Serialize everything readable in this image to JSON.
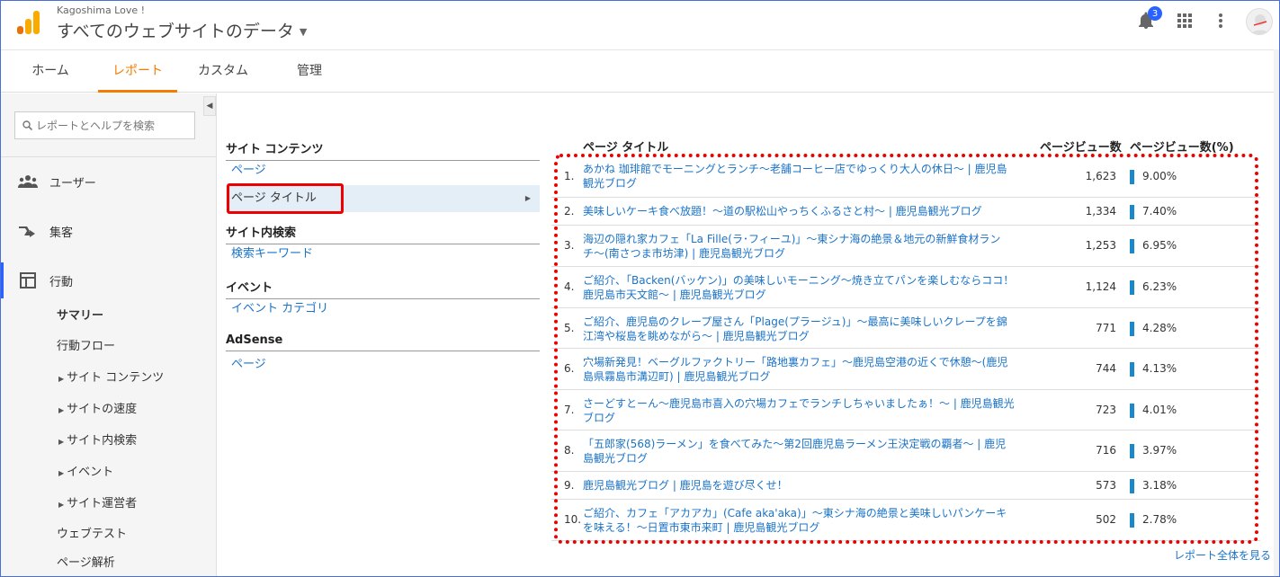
{
  "header": {
    "account": "Kagoshima Love !",
    "property": "すべてのウェブサイトのデータ",
    "notification_count": "3"
  },
  "tabs": [
    {
      "label": "ホーム",
      "active": false
    },
    {
      "label": "レポート",
      "active": true
    },
    {
      "label": "カスタム",
      "active": false
    },
    {
      "label": "管理",
      "active": false
    }
  ],
  "sidebar": {
    "search_placeholder": "レポートとヘルプを検索",
    "main": [
      {
        "label": "ユーザー",
        "icon": "users-icon"
      },
      {
        "label": "集客",
        "icon": "acquisition-icon"
      },
      {
        "label": "行動",
        "icon": "behavior-icon",
        "active": true
      }
    ],
    "sub": [
      {
        "label": "サマリー",
        "bold": true
      },
      {
        "label": "行動フロー"
      },
      {
        "label": "サイト コンテンツ",
        "expandable": true
      },
      {
        "label": "サイトの速度",
        "expandable": true
      },
      {
        "label": "サイト内検索",
        "expandable": true
      },
      {
        "label": "イベント",
        "expandable": true
      },
      {
        "label": "サイト運営者",
        "expandable": true
      },
      {
        "label": "ウェブテスト"
      },
      {
        "label": "ページ解析"
      }
    ]
  },
  "sections": {
    "site_content": {
      "title": "サイト コンテンツ",
      "links": [
        "ページ",
        "ページ タイトル"
      ]
    },
    "site_search": {
      "title": "サイト内検索",
      "links": [
        "検索キーワード"
      ]
    },
    "events": {
      "title": "イベント",
      "links": [
        "イベント カテゴリ"
      ]
    },
    "adsense": {
      "title": "AdSense",
      "links": [
        "ページ"
      ]
    }
  },
  "table": {
    "col_title": "ページ タイトル",
    "col_pv": "ページビュー数",
    "col_pct": "ページビュー数(%)",
    "rows": [
      {
        "rank": "1.",
        "title": "あかね 珈琲館でモーニングとランチ〜老舗コーヒー店でゆっくり大人の休日〜 | 鹿児島観光ブログ",
        "pv": "1,623",
        "pct": "9.00%",
        "share": 9.0
      },
      {
        "rank": "2.",
        "title": "美味しいケーキ食べ放題！〜道の駅松山やっちくふるさと村〜 | 鹿児島観光ブログ",
        "pv": "1,334",
        "pct": "7.40%",
        "share": 7.4
      },
      {
        "rank": "3.",
        "title": "海辺の隠れ家カフェ「La Fille(ラ･フィーユ)」〜東シナ海の絶景＆地元の新鮮食材ランチ〜(南さつま市坊津) | 鹿児島観光ブログ",
        "pv": "1,253",
        "pct": "6.95%",
        "share": 6.95
      },
      {
        "rank": "4.",
        "title": "ご紹介、「Backen(バッケン)」の美味しいモーニング〜焼き立てパンを楽しむならココ！ 鹿児島市天文館〜 | 鹿児島観光ブログ",
        "pv": "1,124",
        "pct": "6.23%",
        "share": 6.23
      },
      {
        "rank": "5.",
        "title": "ご紹介、鹿児島のクレープ屋さん「Plage(プラージュ)」〜最高に美味しいクレープを錦江湾や桜島を眺めながら〜 | 鹿児島観光ブログ",
        "pv": "771",
        "pct": "4.28%",
        "share": 4.28
      },
      {
        "rank": "6.",
        "title": "穴場新発見！ベーグルファクトリー「路地裏カフェ」〜鹿児島空港の近くで休憩〜(鹿児島県霧島市溝辺町) | 鹿児島観光ブログ",
        "pv": "744",
        "pct": "4.13%",
        "share": 4.13
      },
      {
        "rank": "7.",
        "title": "さーどすとーん〜鹿児島市喜入の穴場カフェでランチしちゃいましたぁ！〜 | 鹿児島観光ブログ",
        "pv": "723",
        "pct": "4.01%",
        "share": 4.01
      },
      {
        "rank": "8.",
        "title": "「五郎家(568)ラーメン」を食べてみた〜第2回鹿児島ラーメン王決定戦の覇者〜 | 鹿児島観光ブログ",
        "pv": "716",
        "pct": "3.97%",
        "share": 3.97
      },
      {
        "rank": "9.",
        "title": "鹿児島観光ブログ | 鹿児島を遊び尽くせ！",
        "pv": "573",
        "pct": "3.18%",
        "share": 3.18
      },
      {
        "rank": "10.",
        "title": "ご紹介、カフェ「アカアカ」(Cafe aka'aka)」〜東シナ海の絶景と美味しいパンケーキを味える！〜日置市東市来町 | 鹿児島観光ブログ",
        "pv": "502",
        "pct": "2.78%",
        "share": 2.78
      }
    ],
    "full_report_link": "レポート全体を見る"
  },
  "colors": {
    "accent": "#f57c00",
    "link": "#1a73c8",
    "bar": "#1a88c9",
    "highlight": "#ee0000"
  }
}
